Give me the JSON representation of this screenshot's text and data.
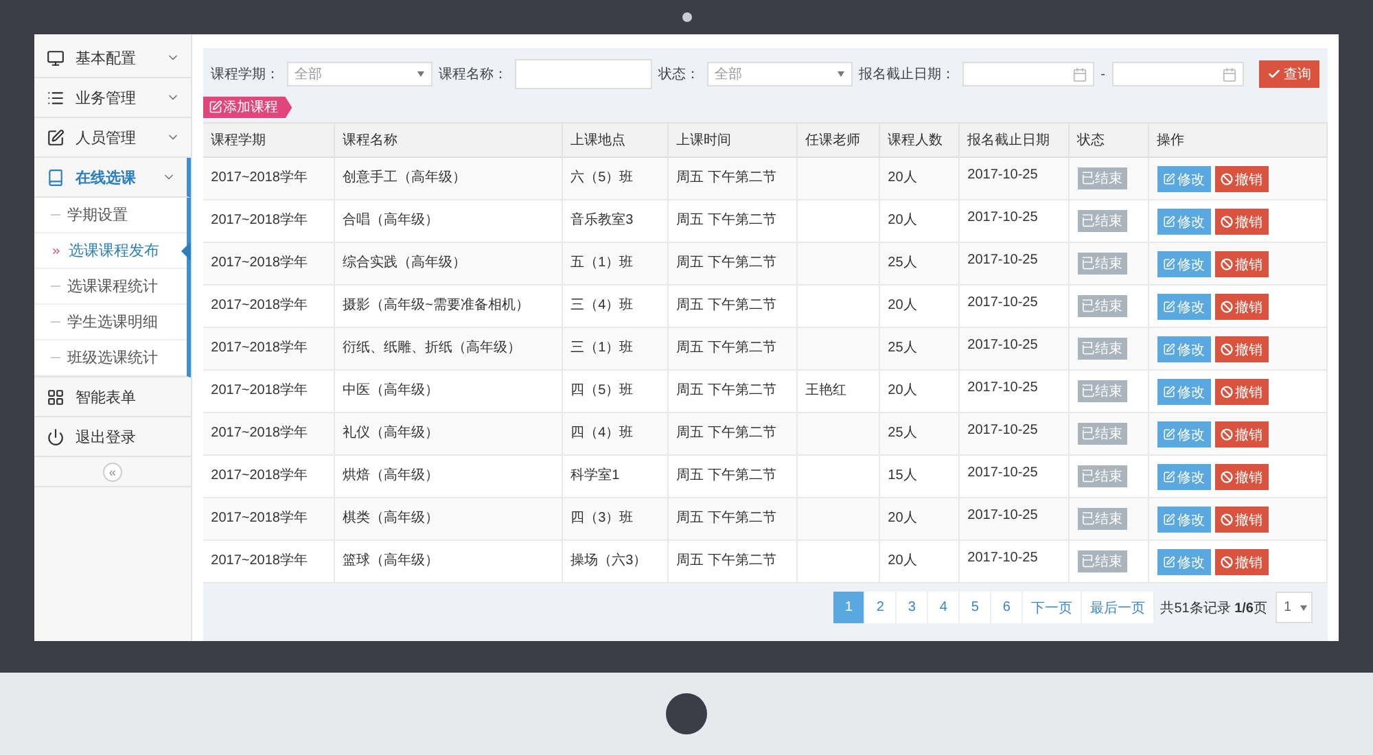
{
  "sidebar": {
    "items": [
      {
        "label": "基本配置",
        "selected": false
      },
      {
        "label": "业务管理",
        "selected": false
      },
      {
        "label": "人员管理",
        "selected": false
      },
      {
        "label": "在线选课",
        "selected": true,
        "children": [
          {
            "label": "学期设置",
            "selected": false
          },
          {
            "label": "选课课程发布",
            "selected": true
          },
          {
            "label": "选课课程统计",
            "selected": false
          },
          {
            "label": "学生选课明细",
            "selected": false
          },
          {
            "label": "班级选课统计",
            "selected": false
          }
        ]
      },
      {
        "label": "智能表单",
        "selected": false
      },
      {
        "label": "退出登录",
        "selected": false
      }
    ],
    "collapse_toggle": "«"
  },
  "filters": [
    {
      "kind": "select",
      "label": "课程学期：",
      "value": "全部"
    },
    {
      "kind": "text",
      "label": "课程名称："
    },
    {
      "kind": "select",
      "label": "状态：",
      "value": "全部"
    },
    {
      "kind": "daterange",
      "label": "报名截止日期：",
      "separator": "-"
    }
  ],
  "search_button": "查询",
  "add_button": "添加课程",
  "table": {
    "columns": [
      "课程学期",
      "课程名称",
      "上课地点",
      "上课时间",
      "任课老师",
      "课程人数",
      "报名截止日期",
      "状态",
      "操作"
    ],
    "rows": [
      {
        "term": "2017~2018学年",
        "name": "创意手工（高年级）",
        "place": "六（5）班",
        "time": "周五 下午第二节",
        "count": "20人",
        "deadline": "2017-10-25",
        "status": "已结束",
        "actions": [
          "修改",
          "撤销"
        ]
      },
      {
        "term": "2017~2018学年",
        "name": "合唱（高年级）",
        "place": "音乐教室3",
        "time": "周五 下午第二节",
        "count": "20人",
        "deadline": "2017-10-25",
        "status": "已结束",
        "actions": [
          "修改",
          "撤销"
        ]
      },
      {
        "term": "2017~2018学年",
        "name": "综合实践（高年级）",
        "place": "五（1）班",
        "time": "周五 下午第二节",
        "count": "25人",
        "deadline": "2017-10-25",
        "status": "已结束",
        "actions": [
          "修改",
          "撤销"
        ]
      },
      {
        "term": "2017~2018学年",
        "name": "摄影（高年级~需要准备相机）",
        "place": "三（4）班",
        "time": "周五 下午第二节",
        "count": "20人",
        "deadline": "2017-10-25",
        "status": "已结束",
        "actions": [
          "修改",
          "撤销"
        ]
      },
      {
        "term": "2017~2018学年",
        "name": "衍纸、纸雕、折纸（高年级）",
        "place": "三（1）班",
        "time": "周五 下午第二节",
        "count": "25人",
        "deadline": "2017-10-25",
        "status": "已结束",
        "actions": [
          "修改",
          "撤销"
        ]
      },
      {
        "term": "2017~2018学年",
        "name": "中医（高年级）",
        "place": "四（5）班",
        "time": "周五 下午第二节",
        "teacher": "王艳红",
        "count": "20人",
        "deadline": "2017-10-25",
        "status": "已结束",
        "actions": [
          "修改",
          "撤销"
        ]
      },
      {
        "term": "2017~2018学年",
        "name": "礼仪（高年级）",
        "place": "四（4）班",
        "time": "周五 下午第二节",
        "count": "25人",
        "deadline": "2017-10-25",
        "status": "已结束",
        "actions": [
          "修改",
          "撤销"
        ]
      },
      {
        "term": "2017~2018学年",
        "name": "烘焙（高年级）",
        "place": "科学室1",
        "time": "周五 下午第二节",
        "count": "15人",
        "deadline": "2017-10-25",
        "status": "已结束",
        "actions": [
          "修改",
          "撤销"
        ]
      },
      {
        "term": "2017~2018学年",
        "name": "棋类（高年级）",
        "place": "四（3）班",
        "time": "周五 下午第二节",
        "count": "20人",
        "deadline": "2017-10-25",
        "status": "已结束",
        "actions": [
          "修改",
          "撤销"
        ]
      },
      {
        "term": "2017~2018学年",
        "name": "篮球（高年级）",
        "place": "操场（六3）",
        "time": "周五 下午第二节",
        "count": "20人",
        "deadline": "2017-10-25",
        "status": "已结束",
        "actions": [
          "修改",
          "撤销"
        ]
      }
    ]
  },
  "pagination": {
    "pages": [
      {
        "label": "1",
        "selected": true
      },
      {
        "label": "2",
        "selected": false
      },
      {
        "label": "3",
        "selected": false
      },
      {
        "label": "4",
        "selected": false
      },
      {
        "label": "5",
        "selected": false
      },
      {
        "label": "6",
        "selected": false
      }
    ],
    "next": "下一页",
    "last": "最后一页",
    "summary": "共51条记录 **1/6**页",
    "page_select": "1"
  }
}
